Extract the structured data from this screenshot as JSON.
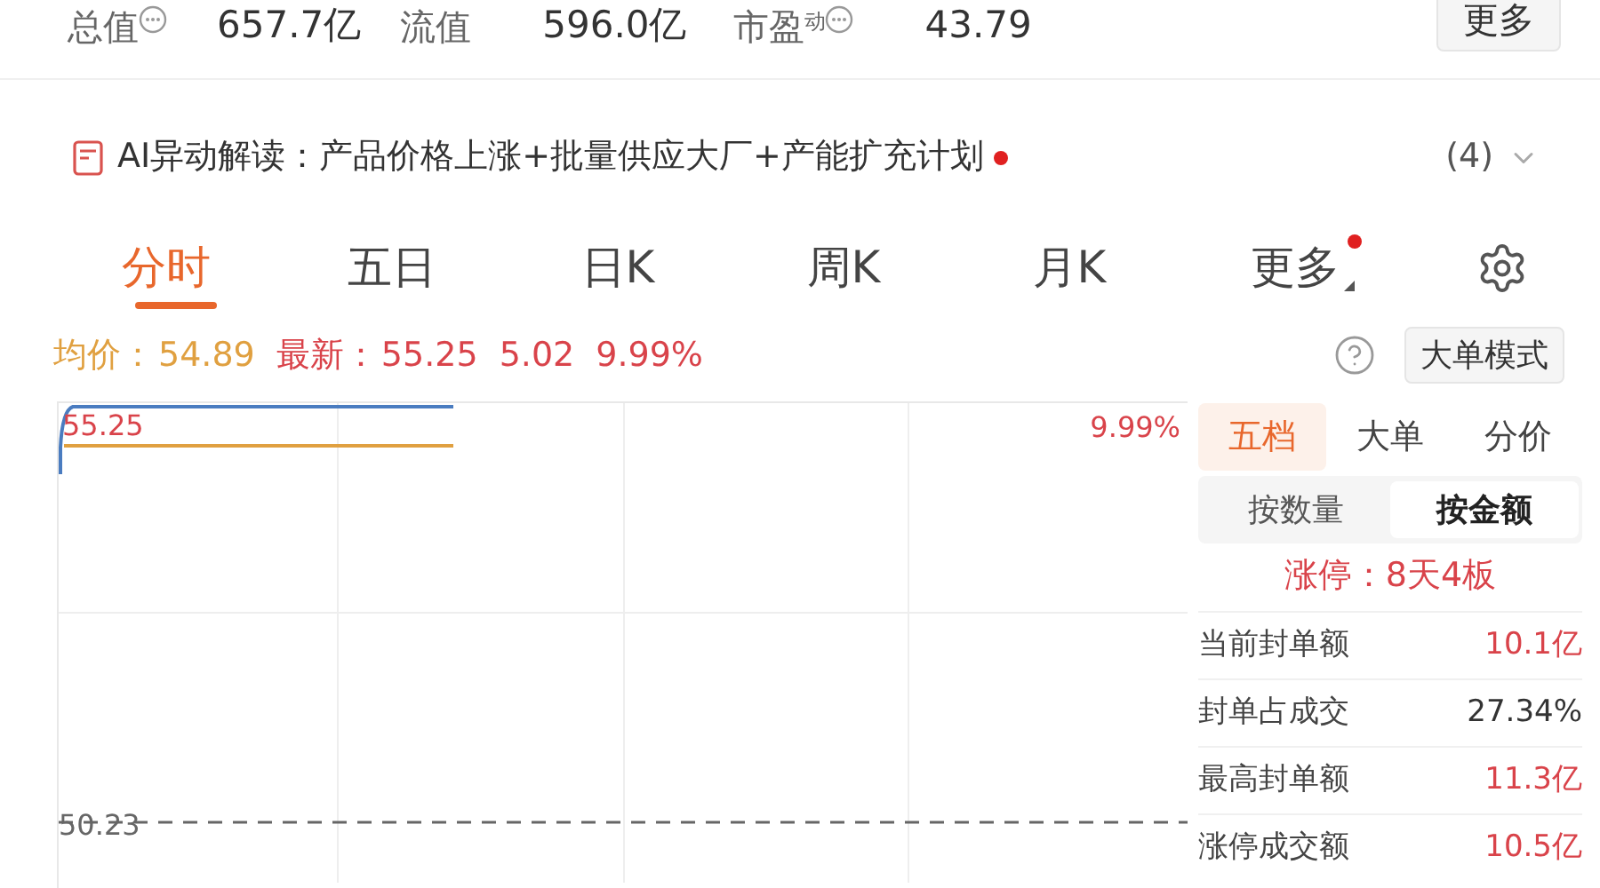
{
  "stats": [
    {
      "label": "总值",
      "info": true,
      "value": "657.7亿"
    },
    {
      "label": "流值",
      "info": false,
      "value": "596.0亿"
    },
    {
      "label": "市盈",
      "sup": "动",
      "info": true,
      "value": "43.79"
    }
  ],
  "more_button": "更多",
  "ai_bar": {
    "text": "AI异动解读：产品价格上涨+批量供应大厂+产能扩充计划",
    "unread": true,
    "count": "(4)"
  },
  "period_tabs": [
    {
      "label": "分时",
      "selected": true,
      "dot": false,
      "caret": false
    },
    {
      "label": "五日",
      "selected": false,
      "dot": false,
      "caret": false
    },
    {
      "label": "日K",
      "selected": false,
      "dot": false,
      "caret": false
    },
    {
      "label": "周K",
      "selected": false,
      "dot": false,
      "caret": false
    },
    {
      "label": "月K",
      "selected": false,
      "dot": false,
      "caret": false
    },
    {
      "label": "更多",
      "selected": false,
      "dot": true,
      "caret": true
    }
  ],
  "quote": {
    "avg_label": "均价：",
    "avg": "54.89",
    "last_label": "最新：",
    "last": "55.25",
    "change": "5.02",
    "pct": "9.99%"
  },
  "mode_button": "大单模式",
  "chart": {
    "top_price": "55.25",
    "top_pct": "9.99%",
    "base_price": "50.23"
  },
  "panel_tabs": [
    {
      "label": "五档",
      "selected": true
    },
    {
      "label": "大单",
      "selected": false
    },
    {
      "label": "分价",
      "selected": false
    }
  ],
  "unit_toggle": [
    {
      "label": "按数量",
      "selected": false
    },
    {
      "label": "按金额",
      "selected": true
    }
  ],
  "limit_up": "涨停：8天4板",
  "metrics": [
    {
      "label": "当前封单额",
      "value": "10.1亿",
      "up": true
    },
    {
      "label": "封单占成交",
      "value": "27.34%",
      "up": false
    },
    {
      "label": "最高封单额",
      "value": "11.3亿",
      "up": true
    },
    {
      "label": "涨停成交额",
      "value": "10.5亿",
      "up": true
    }
  ]
}
